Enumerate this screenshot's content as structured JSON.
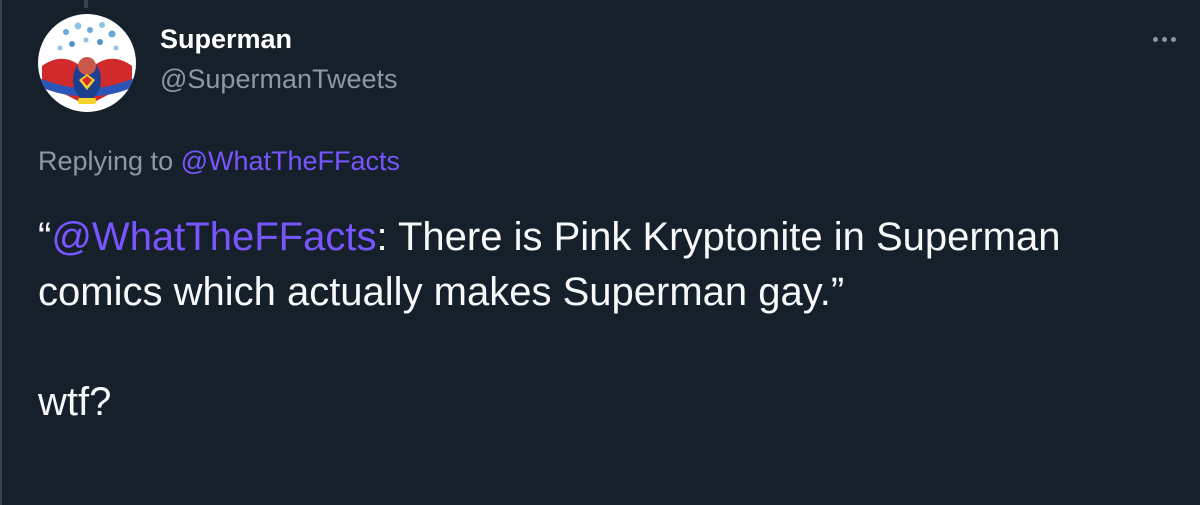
{
  "author": {
    "display_name": "Superman",
    "handle": "@SupermanTweets",
    "avatar_icon": "superman-avatar-icon"
  },
  "more_icon": "more-horizontal-icon",
  "replying": {
    "prefix": "Replying to ",
    "mention": "@WhatTheFFacts"
  },
  "body": {
    "open_quote": "“",
    "mention": "@WhatTheFFacts",
    "text_after_mention": ": There is Pink Kryptonite in Superman comics which actually makes Superman gay.”",
    "second_paragraph": "wtf?"
  },
  "colors": {
    "background": "#15202b",
    "text": "#f7f9f9",
    "secondary_text": "#8b98a5",
    "accent": "#7856ff"
  }
}
